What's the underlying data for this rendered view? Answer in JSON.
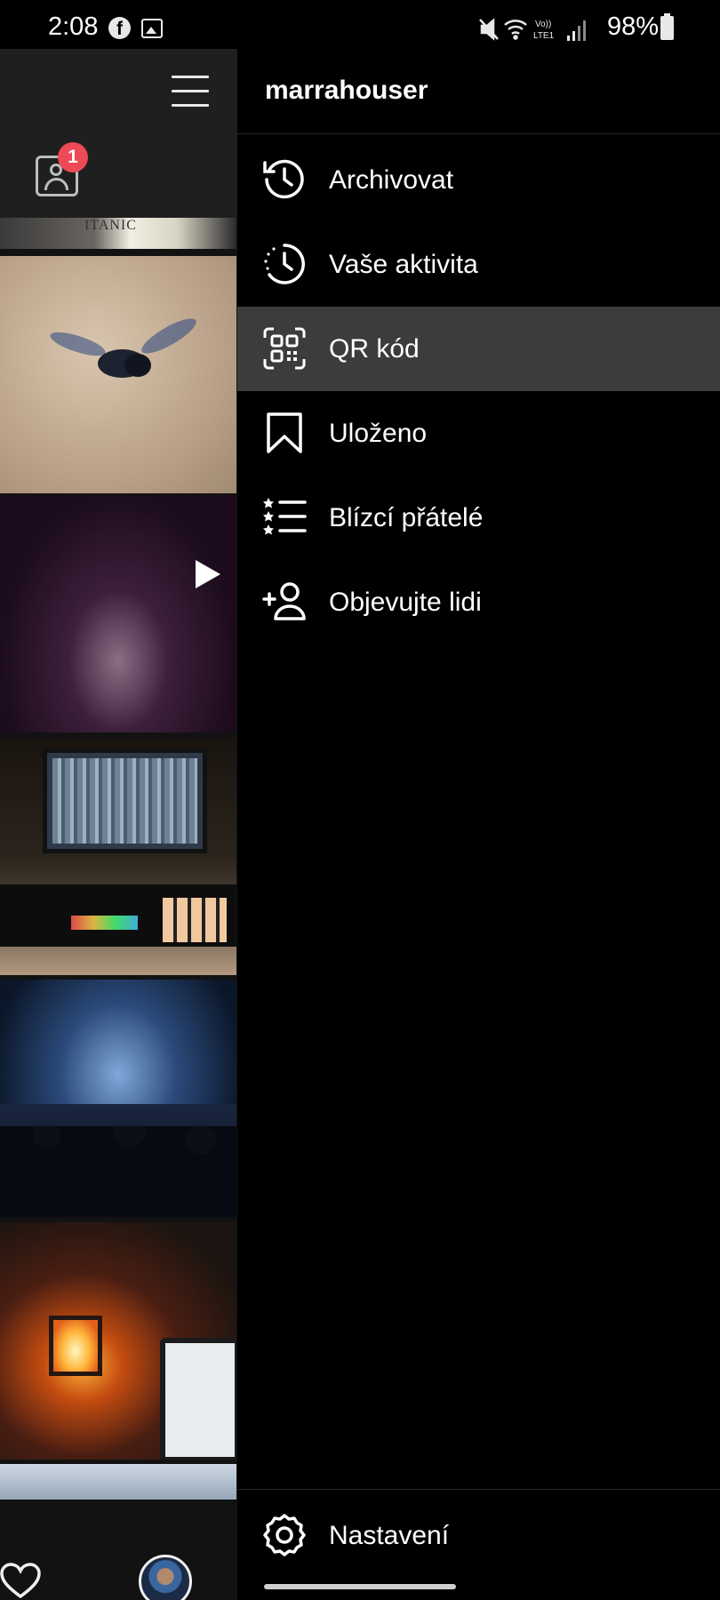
{
  "status_bar": {
    "time": "2:08",
    "battery": "98%",
    "network": "Vo) LTE1"
  },
  "profile": {
    "notification_count": "1",
    "photo_caption_fragment": "ITANIC"
  },
  "drawer": {
    "username": "marrahouser",
    "items": [
      {
        "label": "Archivovat",
        "icon": "archive-clock-icon",
        "active": false
      },
      {
        "label": "Vaše aktivita",
        "icon": "activity-icon",
        "active": false
      },
      {
        "label": "QR kód",
        "icon": "qr-code-icon",
        "active": true
      },
      {
        "label": "Uloženo",
        "icon": "bookmark-icon",
        "active": false
      },
      {
        "label": "Blízcí přátelé",
        "icon": "close-friends-list-icon",
        "active": false
      },
      {
        "label": "Objevujte lidi",
        "icon": "add-person-icon",
        "active": false
      }
    ],
    "settings_label": "Nastavení"
  },
  "colors": {
    "badge": "#ed4956",
    "active_item_bg": "#3c3c3c",
    "drawer_bg": "#000000"
  }
}
